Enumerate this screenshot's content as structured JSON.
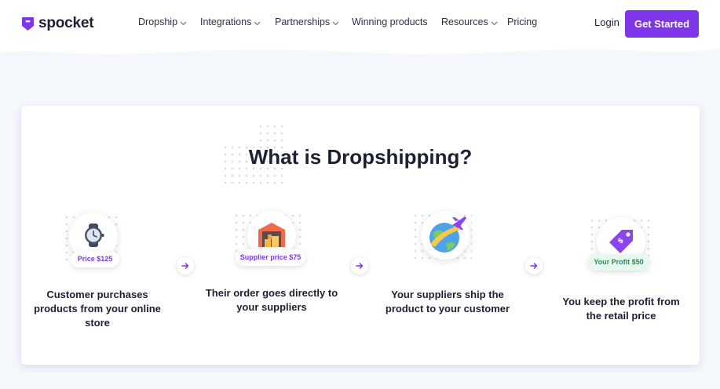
{
  "header": {
    "logo_text": "spocket",
    "nav": [
      {
        "label": "Dropship",
        "has_dropdown": true
      },
      {
        "label": "Integrations",
        "has_dropdown": true
      },
      {
        "label": "Partnerships",
        "has_dropdown": true
      },
      {
        "label": "Winning products",
        "has_dropdown": false
      },
      {
        "label": "Resources",
        "has_dropdown": true
      },
      {
        "label": "Pricing",
        "has_dropdown": false
      }
    ],
    "login_label": "Login",
    "cta_label": "Get Started"
  },
  "section": {
    "title": "What is Dropshipping?",
    "steps": [
      {
        "icon": "watch-icon",
        "badge": "Price $125",
        "caption": "Customer purchases products from your online store"
      },
      {
        "icon": "warehouse-icon",
        "badge": "Supplier price $75",
        "caption": "Their order goes directly to your suppliers"
      },
      {
        "icon": "globe-airplane-icon",
        "badge": "",
        "caption": "Your suppliers ship the product to your customer"
      },
      {
        "icon": "price-tag-icon",
        "badge": "Your Profit $50",
        "caption": "You keep the profit from the retail price"
      }
    ]
  },
  "colors": {
    "brand_purple": "#7f35ea",
    "page_background": "#f4f7fc",
    "profit_green": "#2c8a57"
  }
}
